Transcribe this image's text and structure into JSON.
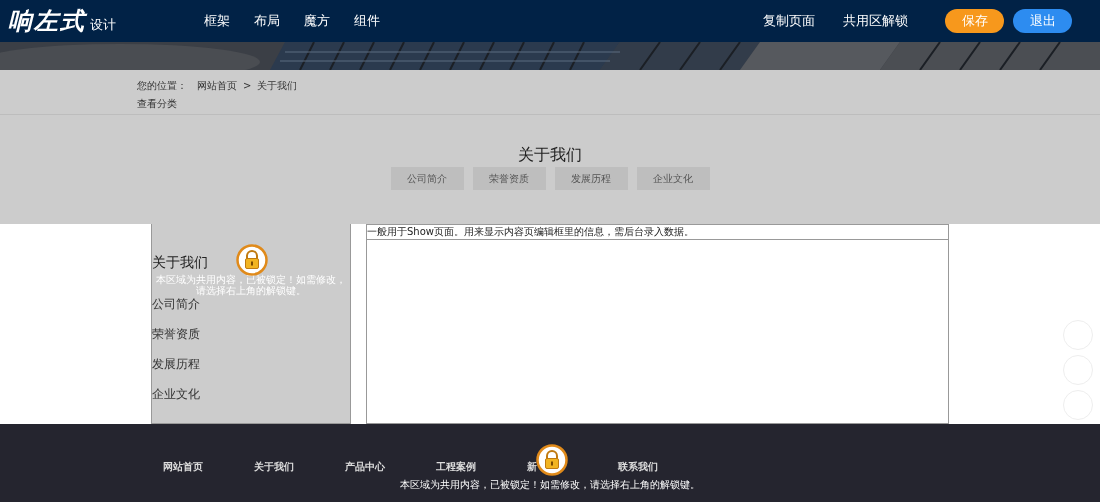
{
  "header": {
    "logo": "响左式",
    "logo_sub": "设计",
    "nav": [
      "框架",
      "布局",
      "魔方",
      "组件"
    ],
    "actions": [
      {
        "label": "复制页面",
        "kind": "link"
      },
      {
        "label": "共用区解锁",
        "kind": "link"
      },
      {
        "label": "保存",
        "kind": "button",
        "color": "#f7981c"
      },
      {
        "label": "退出",
        "kind": "button",
        "color": "#2d8cf0"
      }
    ]
  },
  "location": {
    "label": "您的位置：",
    "crumbs": [
      "网站首页",
      "关于我们"
    ],
    "separator": ">",
    "view_category": "查看分类"
  },
  "section": {
    "title": "关于我们",
    "tabs": [
      "公司简介",
      "荣誉资质",
      "发展历程",
      "企业文化"
    ]
  },
  "sidebar": {
    "title": "关于我们",
    "lock_note": "本区域为共用内容，已被锁定！如需修改，请选择右上角的解锁键。",
    "items": [
      "公司简介",
      "荣誉资质",
      "发展历程",
      "企业文化"
    ]
  },
  "content": {
    "text": "一般用于Show页面。用来显示内容页编辑框里的信息，需后台录入数据。"
  },
  "footer": {
    "nav": [
      "网站首页",
      "关于我们",
      "产品中心",
      "工程案例",
      "新",
      "联系我们"
    ],
    "lock_note": "本区域为共用内容，已被锁定！如需修改，请选择右上角的解锁键。"
  }
}
